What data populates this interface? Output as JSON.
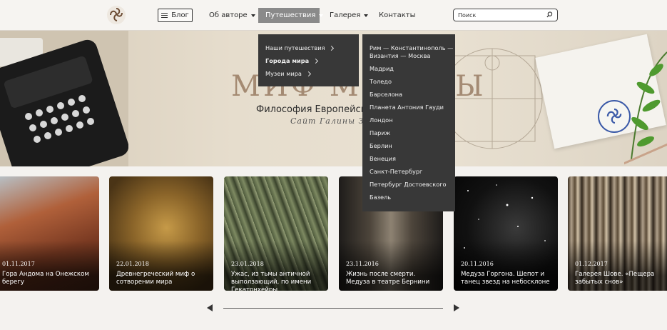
{
  "header": {
    "blog_label": "Блог",
    "nav": [
      {
        "label": "Об авторе"
      },
      {
        "label": "Путешествия"
      },
      {
        "label": "Галерея"
      },
      {
        "label": "Контакты"
      }
    ],
    "search_placeholder": "Поиск"
  },
  "hero": {
    "title": "МИФ МЕДУЗЫ",
    "subtitle": "Философия Европейской",
    "signature": "Сайт Галины Зелен"
  },
  "menu_travel": {
    "items": [
      {
        "label": "Наши путешествия"
      },
      {
        "label": "Города мира"
      },
      {
        "label": "Музеи мира"
      }
    ]
  },
  "menu_cities": {
    "items": [
      {
        "label": "Рим — Константинополь —"
      },
      {
        "label": "Византия — Москва"
      },
      {
        "label": "Мадрид"
      },
      {
        "label": "Толедо"
      },
      {
        "label": "Барселона"
      },
      {
        "label": "Планета Антония Гауди"
      },
      {
        "label": "Лондон"
      },
      {
        "label": "Париж"
      },
      {
        "label": "Берлин"
      },
      {
        "label": "Венеция"
      },
      {
        "label": "Санкт-Петербург"
      },
      {
        "label": "Петербург Достоевского"
      },
      {
        "label": "Базель"
      }
    ]
  },
  "cards": [
    {
      "date": "01.11.2017",
      "title": "Гора Андома на Онежском берегу"
    },
    {
      "date": "22.01.2018",
      "title": "Древнегреческий миф о сотворении мира"
    },
    {
      "date": "23.01.2018",
      "title": "Ужас, из тьмы античной выползающий, по имени Гекатонхейры"
    },
    {
      "date": "23.11.2016",
      "title": "Жизнь после смерти. Медуза в театре Бернини"
    },
    {
      "date": "20.11.2016",
      "title": "Медуза Горгона. Шепот и танец звезд на небосклоне"
    },
    {
      "date": "01.12.2017",
      "title": "Галерея Шове. «Пещера забытых снов»"
    }
  ],
  "icons": {
    "logo": "logo-icon",
    "menu": "menu-icon",
    "caret": "caret-down-icon",
    "search": "search-icon",
    "chevron": "chevron-right-icon",
    "prev": "arrow-left-icon",
    "next": "arrow-right-icon"
  },
  "colors": {
    "menu_bg": "#383838",
    "active_nav": "#8a8a8a",
    "page_bg": "#f4f2ef"
  }
}
